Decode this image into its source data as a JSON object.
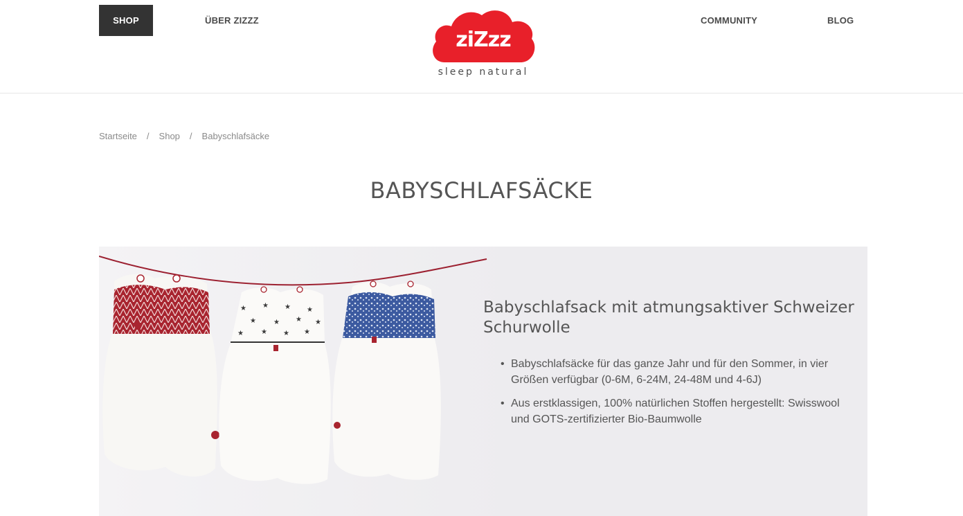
{
  "nav": {
    "shop": "SHOP",
    "about": "ÜBER ZIZZZ",
    "community": "COMMUNITY",
    "blog": "BLOG"
  },
  "logo": {
    "brand": "ziZzz",
    "tagline": "sleep natural",
    "color": "#e8202a"
  },
  "breadcrumb": {
    "items": [
      "Startseite",
      "Shop",
      "Babyschlafsäcke"
    ],
    "separator": "/"
  },
  "page": {
    "title": "BABYSCHLAFSÄCKE"
  },
  "banner": {
    "heading": "Babyschlafsack mit atmungsaktiver Schweizer Schurwolle",
    "bullets": [
      "Babyschlafsäcke für das ganze Jahr und für den Sommer, in vier Größen verfügbar (0-6M, 6-24M, 24-48M und 4-6J)",
      "Aus erstklassigen, 100% natürlichen Stoffen hergestellt: Swisswool und GOTS-zertifizierter Bio-Baumwolle"
    ],
    "image": "three-baby-sleeping-bags-on-clothesline"
  }
}
